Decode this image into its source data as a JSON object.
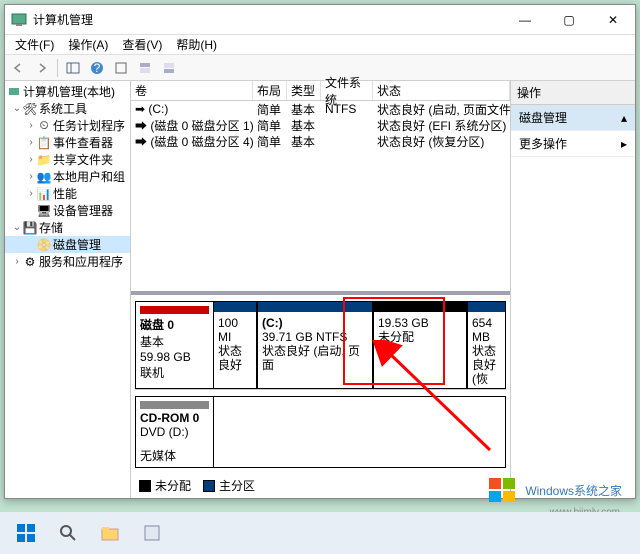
{
  "window": {
    "title": "计算机管理",
    "controls": {
      "min": "—",
      "max": "▢",
      "close": "✕"
    }
  },
  "menubar": [
    "文件(F)",
    "操作(A)",
    "查看(V)",
    "帮助(H)"
  ],
  "tree": {
    "root": "计算机管理(本地)",
    "system_tools": {
      "label": "系统工具",
      "children": [
        "任务计划程序",
        "事件查看器",
        "共享文件夹",
        "本地用户和组",
        "性能",
        "设备管理器"
      ]
    },
    "storage": {
      "label": "存储",
      "children": [
        "磁盘管理"
      ]
    },
    "services": "服务和应用程序"
  },
  "volumes": {
    "headers": {
      "vol": "卷",
      "layout": "布局",
      "type": "类型",
      "fs": "文件系统",
      "status": "状态"
    },
    "rows": [
      {
        "vol": "(C:)",
        "layout": "简单",
        "type": "基本",
        "fs": "NTFS",
        "status": "状态良好 (启动, 页面文件, 故障转储, 基本数据"
      },
      {
        "vol": "(磁盘 0 磁盘分区 1)",
        "layout": "简单",
        "type": "基本",
        "fs": "",
        "status": "状态良好 (EFI 系统分区)"
      },
      {
        "vol": "(磁盘 0 磁盘分区 4)",
        "layout": "简单",
        "type": "基本",
        "fs": "",
        "status": "状态良好 (恢复分区)"
      }
    ]
  },
  "disks": {
    "disk0": {
      "name": "磁盘 0",
      "type": "基本",
      "size": "59.98 GB",
      "state": "联机",
      "parts": [
        {
          "title": "",
          "size": "100 MI",
          "status": "状态良好"
        },
        {
          "title": "(C:)",
          "size": "39.71 GB NTFS",
          "status": "状态良好 (启动, 页面"
        },
        {
          "title": "",
          "size": "19.53 GB",
          "status": "未分配",
          "unalloc": true
        },
        {
          "title": "",
          "size": "654 MB",
          "status": "状态良好 (恢"
        }
      ]
    },
    "cdrom": {
      "name": "CD-ROM 0",
      "line1": "DVD (D:)",
      "line2": "无媒体"
    }
  },
  "legend": {
    "unalloc": "未分配",
    "primary": "主分区"
  },
  "actions": {
    "header": "操作",
    "item1": "磁盘管理",
    "item2": "更多操作"
  },
  "watermark": "Windows系统之家",
  "watermark_url": "www.bjjmlv.com"
}
